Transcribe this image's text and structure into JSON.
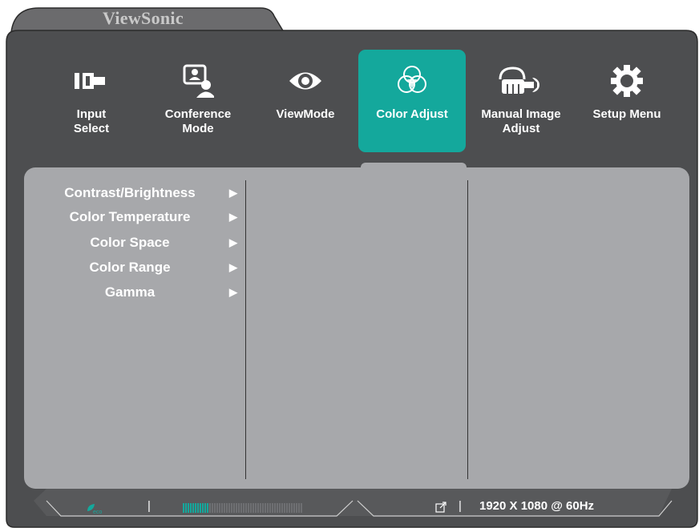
{
  "brand": "ViewSonic",
  "tabs": [
    {
      "label_line1": "Input",
      "label_line2": "Select",
      "icon": "input-select-icon",
      "active": false
    },
    {
      "label_line1": "Conference",
      "label_line2": "Mode",
      "icon": "conference-mode-icon",
      "active": false
    },
    {
      "label_line1": "ViewMode",
      "label_line2": "",
      "icon": "eye-icon",
      "active": false
    },
    {
      "label_line1": "Color Adjust",
      "label_line2": "",
      "icon": "color-circles-icon",
      "active": true
    },
    {
      "label_line1": "Manual Image",
      "label_line2": "Adjust",
      "icon": "hand-wrench-icon",
      "active": false
    },
    {
      "label_line1": "Setup Menu",
      "label_line2": "",
      "icon": "gear-icon",
      "active": false
    }
  ],
  "submenu": [
    {
      "label": "Contrast/Brightness",
      "arrow": "▶"
    },
    {
      "label": "Color Temperature",
      "arrow": "▶"
    },
    {
      "label": "Color Space",
      "arrow": "▶"
    },
    {
      "label": "Color Range",
      "arrow": "▶"
    },
    {
      "label": "Gamma",
      "arrow": "▶"
    }
  ],
  "status": {
    "eco_label": "eco",
    "separator": "|",
    "resolution": "1920 X 1080 @ 60Hz",
    "brightness_level_fraction": 0.22
  },
  "colors": {
    "accent": "#14a89c",
    "frame": "#4d4e50",
    "panel": "#a7a8ab",
    "brand_tab": "#6b6b6d"
  }
}
